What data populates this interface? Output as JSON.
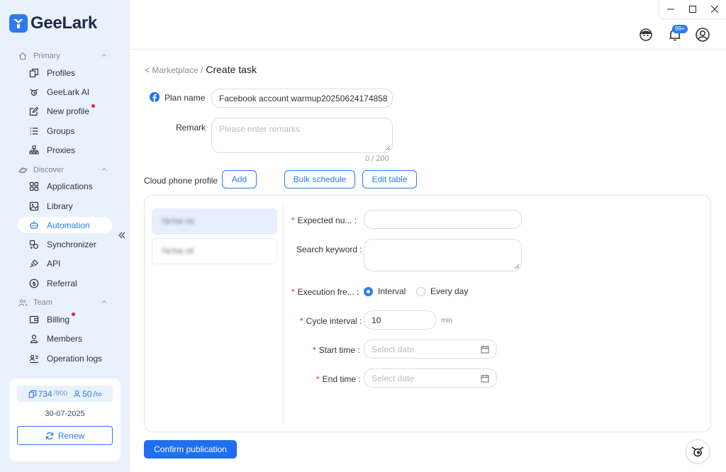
{
  "app": {
    "logo_text": "GeeLark"
  },
  "sidebar": {
    "sections": {
      "primary": "Primary",
      "discover": "Discover",
      "team": "Team"
    },
    "items": {
      "profiles": "Profiles",
      "geelark_ai": "GeeLark AI",
      "new_profile": "New profile",
      "groups": "Groups",
      "proxies": "Proxies",
      "applications": "Applications",
      "library": "Library",
      "automation": "Automation",
      "synchronizer": "Synchronizer",
      "api": "API",
      "referral": "Referral",
      "billing": "Billing",
      "members": "Members",
      "operation_logs": "Operation logs"
    },
    "quota": {
      "profiles_used": "734",
      "profiles_total": "/900",
      "members_used": "50",
      "members_total": "/∞",
      "expiry_date": "30-07-2025",
      "renew_label": "Renew"
    }
  },
  "header": {
    "notification_badge": "99+"
  },
  "breadcrumb": {
    "parent": "< Marketplace /",
    "current": "Create task"
  },
  "form": {
    "plan_name_label": "Plan name",
    "plan_name_value": "Facebook account warmup20250624174858",
    "remark_label": "Remark",
    "remark_placeholder": "Please enter remarks",
    "remark_counter": "0 / 200",
    "cloud_phone_label": "Cloud phone profile",
    "add_label": "Add",
    "bulk_schedule_label": "Bulk schedule",
    "edit_table_label": "Edit table"
  },
  "profiles": [
    {
      "name": "TikTok 09"
    },
    {
      "name": "TikTok 06"
    }
  ],
  "task": {
    "expected_number_label": "Expected nu... :",
    "search_keyword_label": "Search keyword :",
    "execution_frequency_label": "Execution fre... :",
    "freq_interval": "Interval",
    "freq_every_day": "Every day",
    "cycle_interval_label": "Cycle interval :",
    "cycle_interval_value": "10",
    "cycle_interval_unit": "min",
    "start_time_label": "Start time :",
    "start_time_placeholder": "Select date",
    "end_time_label": "End time :",
    "end_time_placeholder": "Select date"
  },
  "footer": {
    "confirm_label": "Confirm publication"
  },
  "colors": {
    "accent": "#2a7bef",
    "sidebar_bg": "#e8f1fc",
    "required": "#e5243b"
  }
}
